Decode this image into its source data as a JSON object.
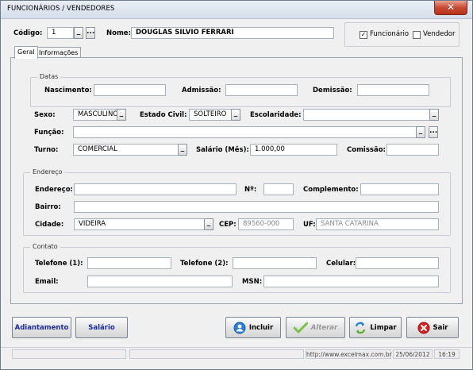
{
  "window": {
    "title": "FUNCIONÁRIOS / VENDEDORES",
    "close_label": "✕"
  },
  "header": {
    "codigo_label": "Código:",
    "codigo_value": "1",
    "nome_label": "Nome:",
    "nome_value": "DOUGLAS SILVIO FERRARI",
    "funcionario_label": "Funcionário",
    "funcionario_checked": true,
    "vendedor_label": "Vendedor",
    "vendedor_checked": false
  },
  "tabs": [
    {
      "label": "Geral",
      "active": true
    },
    {
      "label": "Informações",
      "active": false
    }
  ],
  "datas": {
    "frame_title": "Datas",
    "nascimento_label": "Nascimento:",
    "admissao_label": "Admissão:",
    "demissao_label": "Demissão:"
  },
  "pessoal": {
    "sexo_label": "Sexo:",
    "sexo_value": "MASCULINO",
    "estado_civil_label": "Estado Civil:",
    "estado_civil_value": "SOLTEIRO",
    "escolaridade_label": "Escolaridade:",
    "funcao_label": "Função:",
    "turno_label": "Turno:",
    "turno_value": "COMERCIAL",
    "salario_label": "Salário (Mês):",
    "salario_value": "1.000,00",
    "comissao_label": "Comissão:"
  },
  "endereco": {
    "frame_title": "Endereço",
    "endereco_label": "Endereço:",
    "numero_label": "Nº:",
    "complemento_label": "Complemento:",
    "bairro_label": "Bairro:",
    "cidade_label": "Cidade:",
    "cidade_value": "VIDEIRA",
    "cep_label": "CEP:",
    "cep_value": "89560-000",
    "uf_label": "UF:",
    "uf_value": "SANTA CATARINA"
  },
  "contato": {
    "frame_title": "Contato",
    "telefone1_label": "Telefone (1):",
    "telefone2_label": "Telefone (2):",
    "celular_label": "Celular:",
    "email_label": "Email:",
    "msn_label": "MSN:"
  },
  "buttons": {
    "adiantamento": "Adiantamento",
    "salario": "Salário",
    "incluir": "Incluir",
    "alterar": "Alterar",
    "limpar": "Limpar",
    "sair": "Sair",
    "dropdown_glyph": "_",
    "ellipsis_glyph": "..."
  },
  "status": {
    "url": "http://www.excelmax.com.br",
    "date": "25/06/2012",
    "time": "16:19"
  },
  "colors": {
    "accent_blue": "#1a2a9a",
    "close_red": "#c84a34",
    "incluir_blue": "#2a7fd0",
    "alterar_green": "#5fae3a",
    "sair_red": "#d42020"
  }
}
